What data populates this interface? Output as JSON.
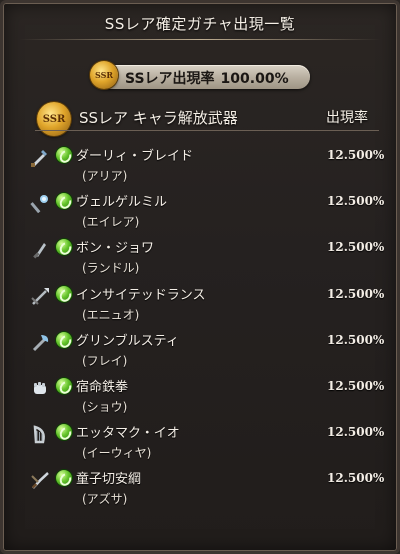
{
  "title": "SSレア確定ガチャ出現一覧",
  "rate_summary": {
    "badge": "SSR",
    "label": "SSレア出現率",
    "value": "100.00%"
  },
  "section": {
    "badge": "SSR",
    "label": "SSレア キャラ解放武器",
    "rate_header": "出現率"
  },
  "items": [
    {
      "weapon": "ダーリィ・ブレイド",
      "character": "(アリア)",
      "rate": "12.500%",
      "weapon_type": "sword-icon"
    },
    {
      "weapon": "ヴェルゲルミル",
      "character": "(エイレア)",
      "rate": "12.500%",
      "weapon_type": "staff-icon"
    },
    {
      "weapon": "ボン・ジョワ",
      "character": "(ランドル)",
      "rate": "12.500%",
      "weapon_type": "dagger-icon"
    },
    {
      "weapon": "インサイテッドランス",
      "character": "(エニュオ)",
      "rate": "12.500%",
      "weapon_type": "spear-icon"
    },
    {
      "weapon": "グリンブルスティ",
      "character": "(フレイ)",
      "rate": "12.500%",
      "weapon_type": "axe-icon"
    },
    {
      "weapon": "宿命鉄拳",
      "character": "(ショウ)",
      "rate": "12.500%",
      "weapon_type": "fist-icon"
    },
    {
      "weapon": "エッタマク・イオ",
      "character": "(イーウィヤ)",
      "rate": "12.500%",
      "weapon_type": "harp-icon"
    },
    {
      "weapon": "童子切安綱",
      "character": "(アズサ)",
      "rate": "12.500%",
      "weapon_type": "katana-icon"
    }
  ],
  "colors": {
    "background": "#252120",
    "gold": "#e0a52a",
    "element_orb": "#63c32a"
  }
}
